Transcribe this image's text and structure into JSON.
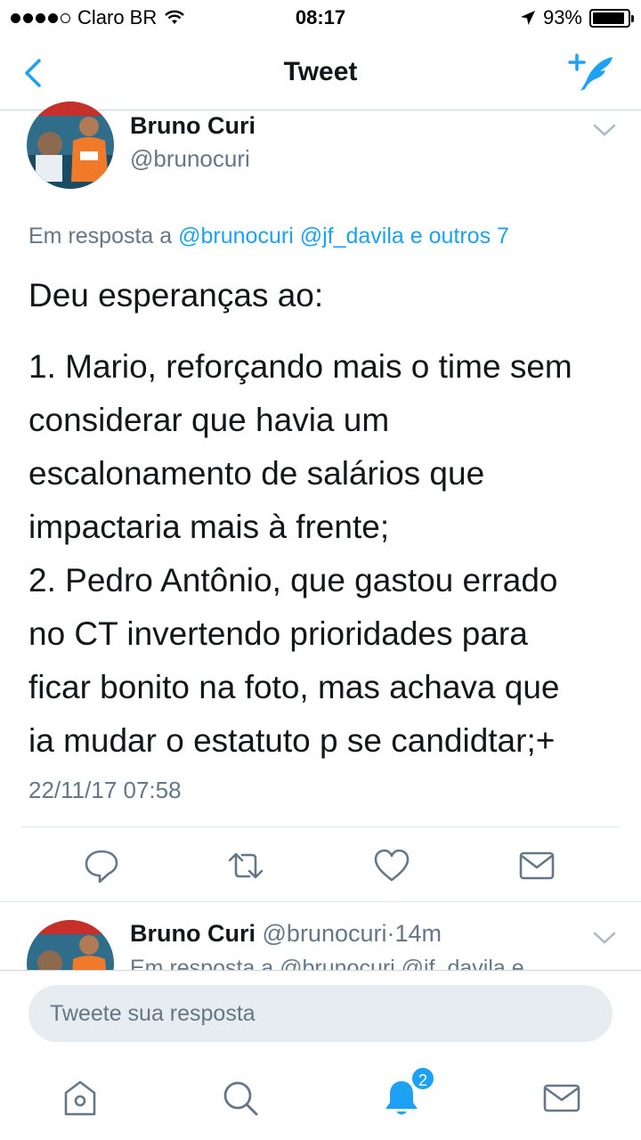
{
  "status_bar": {
    "carrier": "Claro BR",
    "time": "08:17",
    "battery": "93%",
    "battery_level": 0.93
  },
  "nav": {
    "title": "Tweet"
  },
  "tweet": {
    "author_name": "Bruno Curi",
    "author_handle": "@brunocuri",
    "reply_prefix": "Em resposta a",
    "reply_mentions": "@brunocuri @jf_davila e outros 7",
    "text_intro": "Deu esperanças ao:",
    "text_lines": [
      "1. Mario, reforçando mais o time sem",
      "considerar que havia um",
      "escalonamento de salários que",
      "impactaria mais à frente;",
      "2. Pedro Antônio, que gastou errado",
      "no CT invertendo prioridades para",
      "ficar bonito na foto, mas achava que",
      "ia mudar o estatuto p se candidtar;+"
    ],
    "timestamp": "22/11/17 07:58"
  },
  "next_tweet": {
    "author_name": "Bruno Curi",
    "author_handle": "@brunocuri",
    "separator": "·",
    "age": "14m",
    "reply_preview": "Em resposta a @brunocuri @jf_davila e"
  },
  "reply": {
    "placeholder": "Tweete sua resposta"
  },
  "tab_bar": {
    "notifications_badge": "2"
  },
  "colors": {
    "accent": "#1da1f2",
    "secondary_text": "#657786",
    "primary_text": "#14171a",
    "input_bg": "#e6ecf0"
  },
  "icons": {
    "back": "chevron-left-icon",
    "compose": "compose-tweet-icon",
    "caret": "chevron-down-icon",
    "reply": "reply-icon",
    "retweet": "retweet-icon",
    "like": "heart-icon",
    "dm": "envelope-icon",
    "home": "home-icon",
    "search": "search-icon",
    "notifications": "bell-icon",
    "messages": "envelope-icon"
  }
}
